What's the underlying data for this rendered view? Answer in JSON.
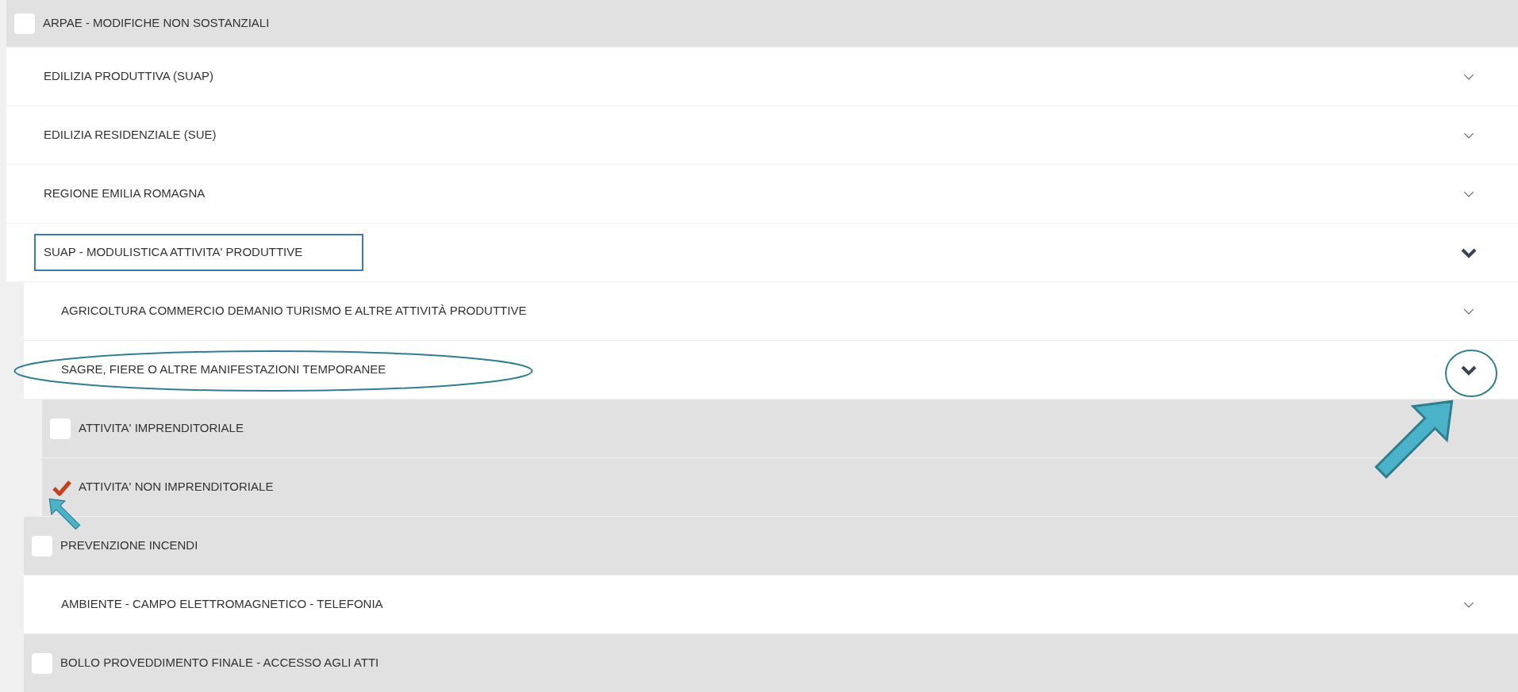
{
  "items": [
    {
      "kind": "checkbox",
      "label": "ARPAE - MODIFICHE NON SOSTANZIALI",
      "checked": false
    },
    {
      "kind": "category",
      "label": "EDILIZIA PRODUTTIVA (SUAP)",
      "expanded": false,
      "focused": false
    },
    {
      "kind": "category",
      "label": "EDILIZIA RESIDENZIALE (SUE)",
      "expanded": false,
      "focused": false
    },
    {
      "kind": "category",
      "label": "REGIONE EMILIA ROMAGNA",
      "expanded": false,
      "focused": false
    },
    {
      "kind": "category",
      "label": "SUAP - MODULISTICA ATTIVITA' PRODUTTIVE",
      "expanded": true,
      "focused": true,
      "children": [
        {
          "kind": "category",
          "label": "AGRICOLTURA COMMERCIO DEMANIO TURISMO E ALTRE ATTIVITÀ PRODUTTIVE",
          "expanded": false,
          "focused": false
        },
        {
          "kind": "category",
          "label": "SAGRE, FIERE O ALTRE MANIFESTAZIONI TEMPORANEE",
          "expanded": true,
          "focused": false,
          "annotated": true,
          "children": [
            {
              "kind": "checkbox",
              "label": "ATTIVITA' IMPRENDITORIALE",
              "checked": false
            },
            {
              "kind": "checkbox",
              "label": "ATTIVITA' NON IMPRENDITORIALE",
              "checked": true,
              "annotated": true
            }
          ]
        },
        {
          "kind": "checkbox",
          "label": "PREVENZIONE INCENDI",
          "checked": false
        },
        {
          "kind": "category",
          "label": "AMBIENTE - CAMPO ELETTROMAGNETICO - TELEFONIA",
          "expanded": false,
          "focused": false
        },
        {
          "kind": "checkbox",
          "label": "BOLLO PROVEDDIMENTO FINALE - ACCESSO AGLI ATTI",
          "checked": false
        }
      ]
    }
  ]
}
